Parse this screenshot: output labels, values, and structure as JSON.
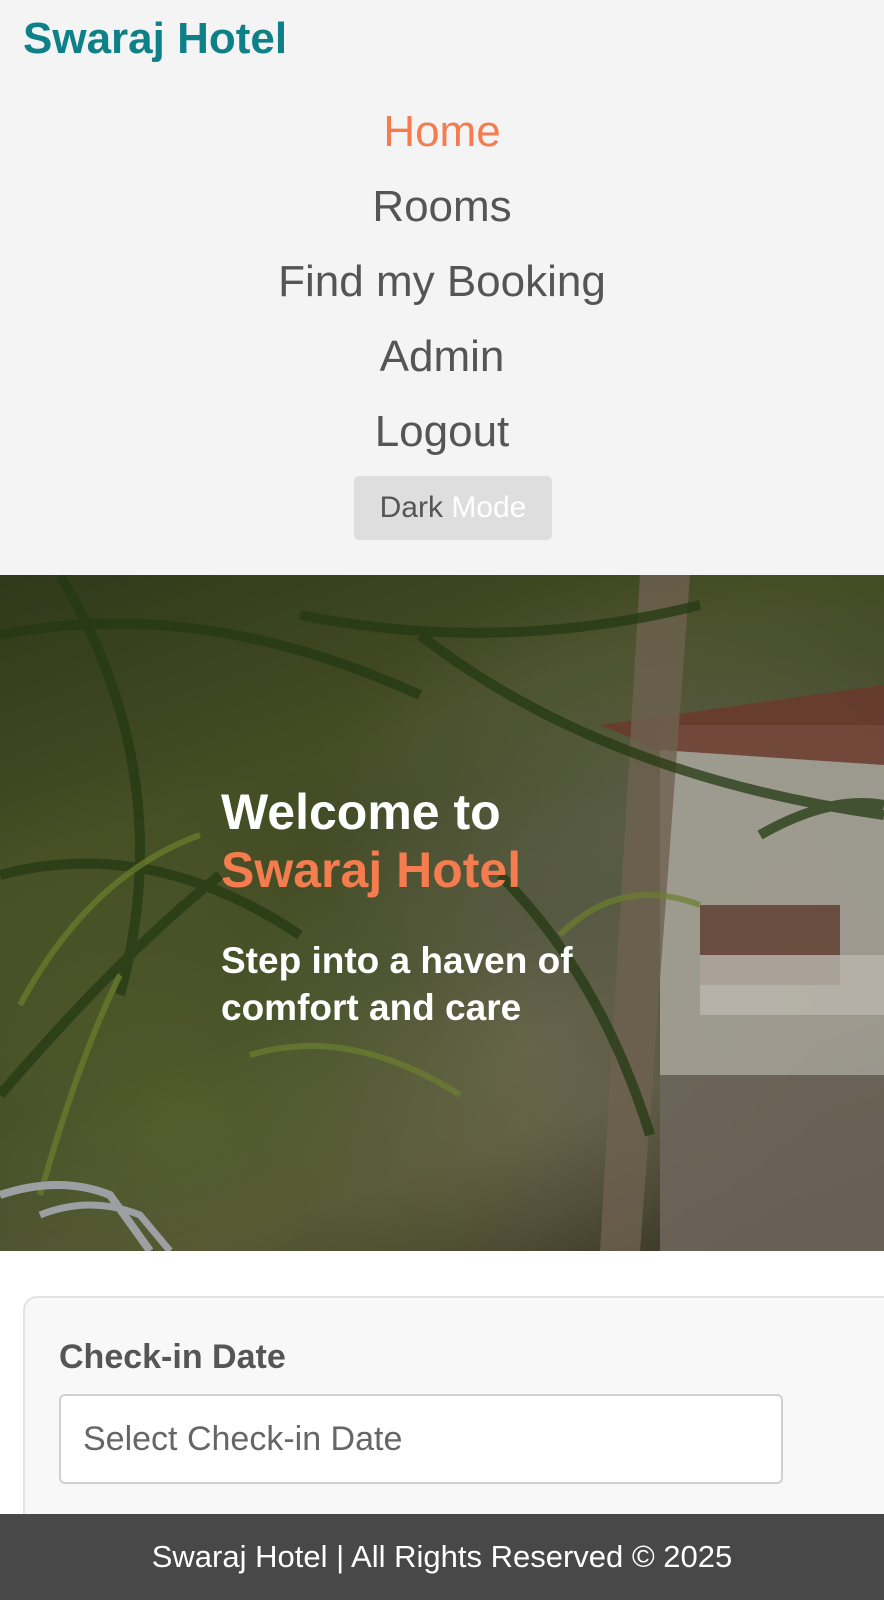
{
  "header": {
    "brand": "Swaraj Hotel",
    "nav": [
      {
        "label": "Home",
        "active": true
      },
      {
        "label": "Rooms"
      },
      {
        "label": "Find my Booking"
      },
      {
        "label": "Admin"
      },
      {
        "label": "Logout"
      }
    ],
    "dark_mode": {
      "part1": "Dark",
      "part2": "Mode"
    }
  },
  "hero": {
    "title_line1": "Welcome to",
    "title_line2": "Swaraj Hotel",
    "subtitle": "Step into a haven of comfort and care"
  },
  "booking": {
    "checkin_label": "Check-in Date",
    "checkin_placeholder": "Select Check-in Date"
  },
  "footer": {
    "text": "Swaraj Hotel | All Rights Reserved © 2025"
  },
  "colors": {
    "brand": "#0e8188",
    "accent": "#f47c4f",
    "footer_bg": "#484848"
  }
}
